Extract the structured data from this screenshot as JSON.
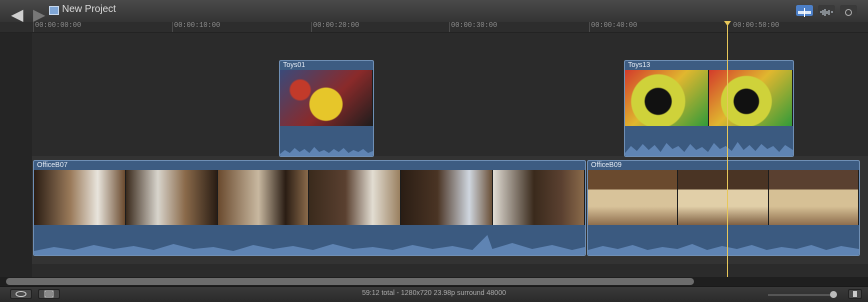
{
  "window": {
    "title": "New Project",
    "back_glyph": "◀",
    "forward_glyph": "▶"
  },
  "ruler": {
    "timecodes": [
      "00:00:00:00",
      "00:00:10:00",
      "00:00:20:00",
      "00:00:30:00",
      "00:00:40:00",
      "00:00:50:00"
    ]
  },
  "clips": {
    "toys01": {
      "name": "Toys01"
    },
    "toys13": {
      "name": "Toys13"
    },
    "office07": {
      "name": "OfficeB07"
    },
    "office09": {
      "name": "OfficeB09"
    }
  },
  "status": {
    "text": "59:12 total - 1280x720 23.98p surround 48000"
  },
  "colors": {
    "clip_blue": "#3d5c82",
    "playhead": "#e7c75a",
    "marker_blue": "#5aa0e6",
    "marker_red": "#d9534f",
    "marker_yellow": "#d8c24a"
  },
  "icons": [
    "back-icon",
    "forward-icon",
    "project-icon",
    "clip-skimming-icon",
    "audio-skimming-icon",
    "solo-icon",
    "timeline-index-icon",
    "clip-appearance-icon",
    "zoom-slider-icon"
  ]
}
